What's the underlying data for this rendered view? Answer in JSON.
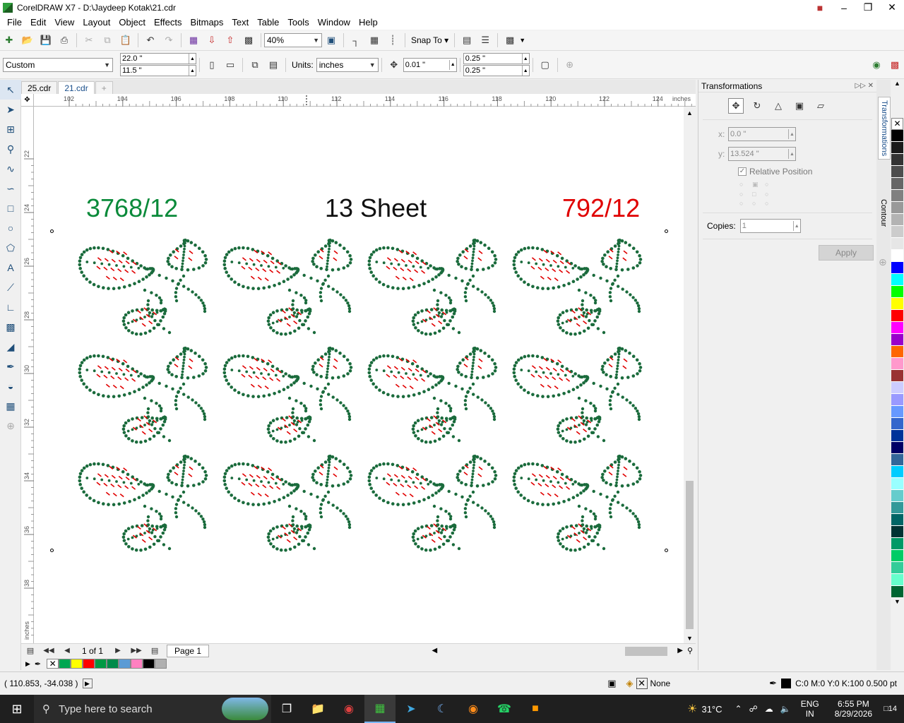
{
  "window": {
    "title": "CorelDRAW X7 - D:\\Jaydeep Kotak\\21.cdr"
  },
  "menu": [
    "File",
    "Edit",
    "View",
    "Layout",
    "Object",
    "Effects",
    "Bitmaps",
    "Text",
    "Table",
    "Tools",
    "Window",
    "Help"
  ],
  "standard_toolbar": {
    "zoom": "40%",
    "snap_to": "Snap To"
  },
  "property_bar": {
    "page_size": "Custom",
    "width": "22.0 \"",
    "height": "11.5 \"",
    "units_label": "Units:",
    "units": "inches",
    "nudge": "0.01 \"",
    "dup_x": "0.25 \"",
    "dup_y": "0.25 \""
  },
  "doc_tabs": [
    "25.cdr",
    "21.cdr"
  ],
  "ruler": {
    "h_ticks": [
      "102",
      "104",
      "106",
      "108",
      "110",
      "112",
      "114",
      "116",
      "118",
      "120",
      "122",
      "124"
    ],
    "h_unit": "inches",
    "v_ticks": [
      "22",
      "24",
      "26",
      "28",
      "30",
      "32",
      "34",
      "36",
      "38"
    ],
    "v_unit": "inches"
  },
  "canvas": {
    "label_left": "3768/12",
    "label_center": "13 Sheet",
    "label_right": "792/12",
    "label_left_color": "#0a8a3a",
    "label_right_color": "#e00000",
    "motif_rows": 3,
    "motif_cols": 4,
    "dot_color": "#1a6b3c",
    "dash_color": "#e00000"
  },
  "page_nav": {
    "count": "1 of 1",
    "page_tab": "Page 1"
  },
  "doc_palette_colors": [
    "#00a651",
    "#ffff00",
    "#ff0000",
    "#009944",
    "#008a4a",
    "#5b9bd5",
    "#ff80c0",
    "#000000",
    "#b0b0b0"
  ],
  "transformations": {
    "title": "Transformations",
    "x_label": "x:",
    "x": "0.0 \"",
    "y_label": "y:",
    "y": "13.524 \"",
    "relative_position": "Relative Position",
    "copies_label": "Copies:",
    "copies": "1",
    "apply": "Apply"
  },
  "panel_tabs": [
    "Transformations",
    "Contour"
  ],
  "palette_colors": [
    "#000000",
    "#1a1a1a",
    "#333333",
    "#4d4d4d",
    "#666666",
    "#808080",
    "#999999",
    "#b3b3b3",
    "#cccccc",
    "#e6e6e6",
    "#ffffff",
    "#0000ff",
    "#00ffff",
    "#00ff00",
    "#ffff00",
    "#ff0000",
    "#ff00ff",
    "#9900cc",
    "#ff6600",
    "#ff99cc",
    "#993333",
    "#ccccff",
    "#9999ff",
    "#6699ff",
    "#3366cc",
    "#003399",
    "#000066",
    "#336699",
    "#00ccff",
    "#99ffff",
    "#66cccc",
    "#339999",
    "#006666",
    "#003333",
    "#009966",
    "#00cc66",
    "#33cc99",
    "#66ffcc",
    "#006633"
  ],
  "status": {
    "coords": "( 110.853, -34.038 )",
    "fill": "None",
    "outline": "C:0 M:0 Y:0 K:100  0.500 pt"
  },
  "taskbar": {
    "search": "Type here to search",
    "temp": "31°C",
    "lang1": "ENG",
    "lang2": "IN",
    "time": "6:55 PM",
    "date": "8/29/2026",
    "notif": "14"
  }
}
